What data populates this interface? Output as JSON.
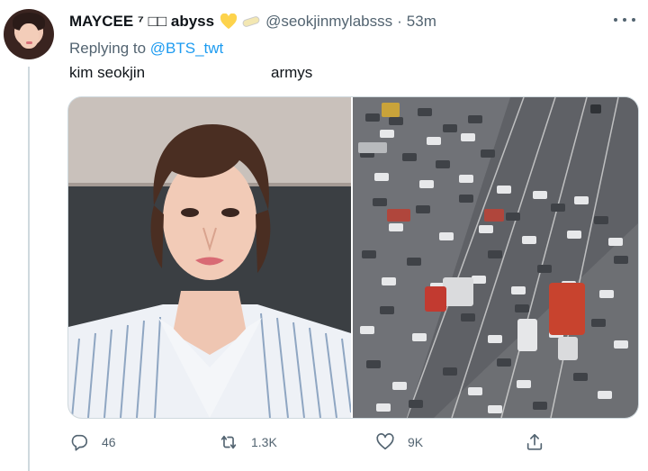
{
  "tweet": {
    "display_name": "MAYCEE ⁷ □□ abyss",
    "handle": "@seokjinmylabsss",
    "separator": "·",
    "time": "53m",
    "replying_prefix": "Replying to ",
    "replying_to": "@BTS_twt",
    "text_left": "kim seokjin",
    "text_right": "armys"
  },
  "actions": {
    "reply_count": "46",
    "retweet_count": "1.3K",
    "like_count": "9K"
  },
  "icons": {
    "heart": "yellow-heart-icon",
    "badge": "badge-icon",
    "more": "more-icon",
    "reply": "reply-icon",
    "retweet": "retweet-icon",
    "like": "like-icon",
    "share": "share-icon"
  },
  "colors": {
    "accent": "#1d9bf0",
    "secondary_text": "#536471",
    "border": "#cfd9de",
    "heart": "#fdd34c"
  }
}
